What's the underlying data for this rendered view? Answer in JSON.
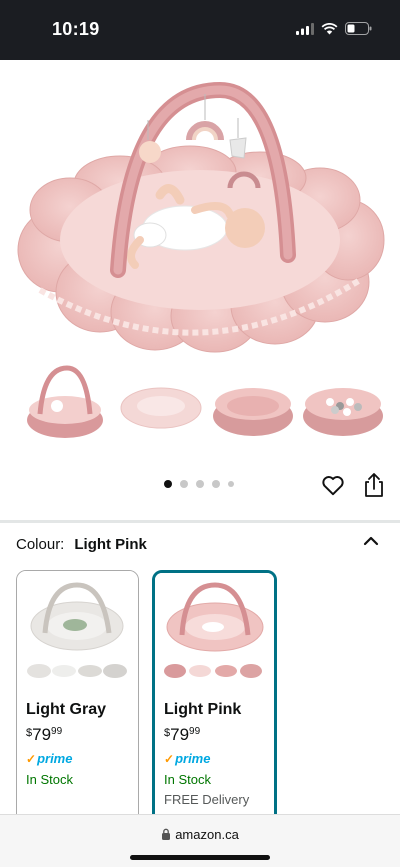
{
  "status_bar": {
    "time": "10:19",
    "icons": [
      "signal-icon",
      "wifi-icon",
      "battery-icon"
    ]
  },
  "gallery": {
    "image_description_icon": "pink-play-gym-icon",
    "thumbnail_count": 4,
    "page_dots": 5,
    "active_dot": 0
  },
  "actions": {
    "favorite_icon": "heart-icon",
    "share_icon": "share-icon"
  },
  "colour": {
    "label": "Colour:",
    "value": "Light Pink",
    "toggle_icon": "chevron-up-icon"
  },
  "swatches": [
    {
      "name": "Light Gray",
      "price_symbol": "$",
      "price_whole": "79",
      "price_cents": "99",
      "prime": "prime",
      "stock": "In Stock",
      "delivery": "",
      "selected": false,
      "color": "#e8e6e3"
    },
    {
      "name": "Light Pink",
      "price_symbol": "$",
      "price_whole": "79",
      "price_cents": "99",
      "prime": "prime",
      "stock": "In Stock",
      "delivery": "FREE Delivery",
      "selected": true,
      "color": "#f2c4c4"
    }
  ],
  "browser": {
    "url": "amazon.ca"
  },
  "colors": {
    "selected_border": "#007185",
    "in_stock": "#007600",
    "prime_blue": "#00a8e1",
    "prime_check": "#ff9900",
    "product_pink": "#f2c4c4"
  }
}
